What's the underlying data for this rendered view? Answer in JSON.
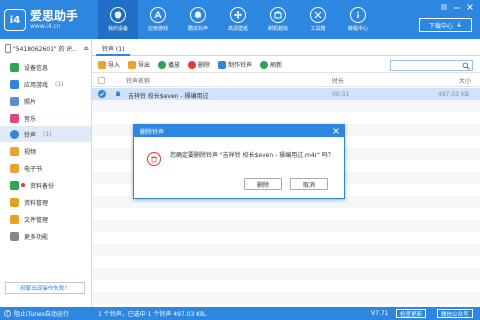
{
  "app": {
    "name": "爱思助手",
    "url": "www.i4.cn",
    "download_label": "下载中心",
    "accent_color": "#2d86df"
  },
  "nav": [
    {
      "label": "我的设备",
      "icon": "apple-icon"
    },
    {
      "label": "应用游戏",
      "icon": "app-store-icon"
    },
    {
      "label": "酷炫铃声",
      "icon": "bell-icon"
    },
    {
      "label": "高清壁纸",
      "icon": "flower-icon"
    },
    {
      "label": "刷机越狱",
      "icon": "box-icon"
    },
    {
      "label": "工具箱",
      "icon": "tools-icon"
    },
    {
      "label": "教程中心",
      "icon": "info-icon"
    }
  ],
  "device": {
    "name": "\"5418062601\" 的 iP..."
  },
  "sidebar": [
    {
      "label": "设备信息",
      "count": "",
      "color": "#2ea44f"
    },
    {
      "label": "应用游戏",
      "count": "(1)",
      "color": "#2d86df"
    },
    {
      "label": "照片",
      "count": "",
      "color": "#5b8fd6"
    },
    {
      "label": "音乐",
      "count": "",
      "color": "#e0457b"
    },
    {
      "label": "铃声",
      "count": "(1)",
      "color": "#2d86df"
    },
    {
      "label": "视频",
      "count": "",
      "color": "#f0a030"
    },
    {
      "label": "电子书",
      "count": "",
      "color": "#f0a030"
    },
    {
      "label": "资料备份",
      "count": "",
      "color": "#2ea44f"
    },
    {
      "label": "资料管理",
      "count": "",
      "color": "#e8a020"
    },
    {
      "label": "文件管理",
      "count": "",
      "color": "#e8a020"
    },
    {
      "label": "更多功能",
      "count": "",
      "color": "#888888"
    }
  ],
  "help_label": "频繁出现操作失败？",
  "tab": {
    "label": "铃声 (1)"
  },
  "toolbar": [
    {
      "label": "导入",
      "icon": "import-icon",
      "color": "#f0a030"
    },
    {
      "label": "导出",
      "icon": "export-icon",
      "color": "#f0a030"
    },
    {
      "label": "播放",
      "icon": "play-icon",
      "color": "#2ea44f"
    },
    {
      "label": "删除",
      "icon": "delete-icon",
      "color": "#e53935"
    },
    {
      "label": "制作铃声",
      "icon": "make-ringtone-icon",
      "color": "#2d86df"
    },
    {
      "label": "刷新",
      "icon": "refresh-icon",
      "color": "#2ea44f"
    }
  ],
  "table": {
    "headers": {
      "name": "铃声名称",
      "duration": "时长",
      "size": "大小"
    },
    "rows": [
      {
        "name": "吉祥铃 校长$even - 操编用过",
        "duration": "00:31",
        "size": "497.03 KB"
      }
    ]
  },
  "dialog": {
    "title": "删除铃声",
    "message": "您确定要删除铃声 \"吉祥铃 校长$even - 操编用过.m4r\" 吗？",
    "delete_label": "删除",
    "cancel_label": "取消"
  },
  "status": {
    "itunes": "阻止iTunes自动运行",
    "info": "1 个铃声，已选中 1 个铃声 497.03 KB。",
    "version": "V7.71",
    "check_update": "检查更新",
    "wechat": "微信公众号"
  }
}
